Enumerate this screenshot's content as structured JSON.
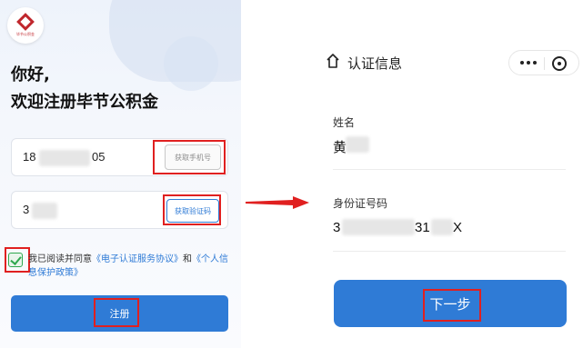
{
  "left": {
    "logo_text": "毕节公积金",
    "greeting_line1": "你好,",
    "greeting_line2": "欢迎注册毕节公积金",
    "phone": {
      "prefix": "18",
      "suffix": "05",
      "button": "获取手机号"
    },
    "code": {
      "prefix": "3",
      "button": "获取验证码"
    },
    "agreement": {
      "prefix": "我已阅读并同意",
      "link1": "《电子认证服务协议》",
      "conjunction": "和",
      "link2": "《个人信息保护政策》"
    },
    "register_button": "注册"
  },
  "right": {
    "title": "认证信息",
    "name_label": "姓名",
    "name_value": "黄",
    "id_label": "身份证号码",
    "id_prefix": "3",
    "id_mid": "31",
    "id_suffix": "X",
    "next_button": "下一步"
  },
  "colors": {
    "primary": "#2f7bd6",
    "highlight": "#e02020",
    "check": "#2fa84f"
  },
  "icons": [
    "home-icon",
    "more-dots-icon",
    "close-target-icon",
    "checkbox-check-icon",
    "arrow-right-icon"
  ]
}
